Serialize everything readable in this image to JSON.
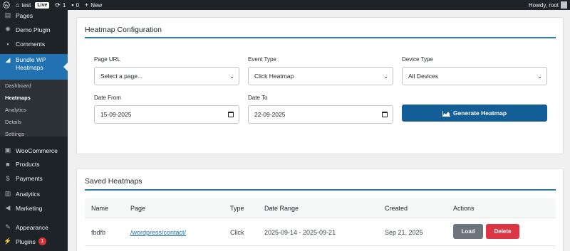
{
  "adminbar": {
    "site_name": "test",
    "live_badge": "Live",
    "updates_count": "1",
    "comments_count": "0",
    "new_label": "New",
    "howdy": "Howdy, root"
  },
  "sidebar": {
    "items": [
      {
        "label": "Pages",
        "icon": "pages-icon"
      },
      {
        "label": "Demo Plugin",
        "icon": "gear-icon"
      },
      {
        "label": "Comments",
        "icon": "comment-icon"
      },
      {
        "label": "Bundle WP Heatmaps",
        "label_line1": "Bundle WP",
        "label_line2": "Heatmaps",
        "icon": "chart-area-icon"
      },
      {
        "label": "WooCommerce",
        "icon": "woo-icon"
      },
      {
        "label": "Products",
        "icon": "products-icon"
      },
      {
        "label": "Payments",
        "icon": "payments-icon"
      },
      {
        "label": "Analytics",
        "icon": "analytics-icon"
      },
      {
        "label": "Marketing",
        "icon": "megaphone-icon"
      },
      {
        "label": "Appearance",
        "icon": "brush-icon"
      },
      {
        "label": "Plugins",
        "icon": "plug-icon",
        "badge": "1"
      }
    ],
    "submenu": [
      "Dashboard",
      "Heatmaps",
      "Analytics",
      "Details",
      "Settings"
    ]
  },
  "config": {
    "title": "Heatmap Configuration",
    "page_url_label": "Page URL",
    "page_url_value": "Select a page...",
    "event_type_label": "Event Type",
    "event_type_value": "Click Heatmap",
    "device_type_label": "Device Type",
    "device_type_value": "All Devices",
    "date_from_label": "Date From",
    "date_from_value": "15-09-2025",
    "date_to_label": "Date To",
    "date_to_value": "22-09-2025",
    "generate_label": "Generate Heatmap"
  },
  "saved": {
    "title": "Saved Heatmaps",
    "columns": [
      "Name",
      "Page",
      "Type",
      "Date Range",
      "Created",
      "Actions"
    ],
    "rows": [
      {
        "name": "fbdfb",
        "page": "/wordpress/contact/",
        "type": "Click",
        "date_range": "2025-09-14 - 2025-09-21",
        "created": "Sep 21, 2025"
      }
    ],
    "load_label": "Load",
    "delete_label": "Delete"
  },
  "colors": {
    "accent": "#2271b1",
    "primary_button": "#135e96",
    "load_button": "#6c757d",
    "delete_button": "#dc3545",
    "admin_dark": "#1d2327"
  }
}
